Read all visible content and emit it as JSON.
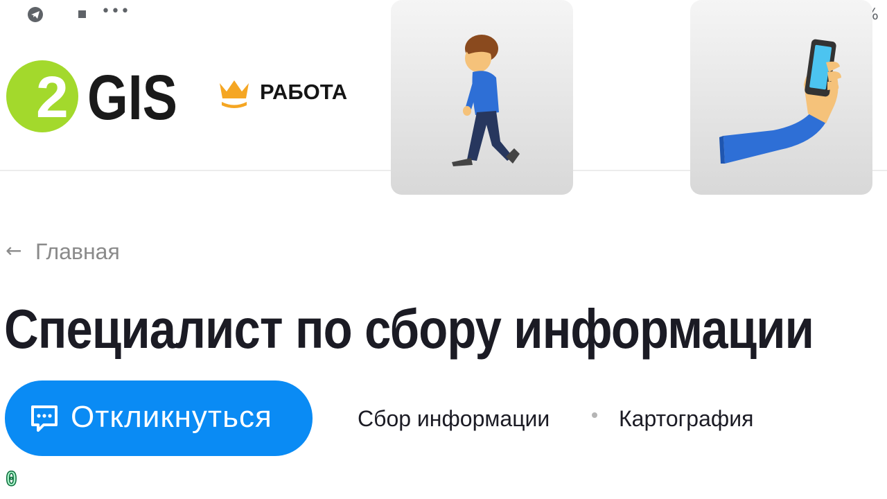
{
  "status_bar": {
    "left_icons": [
      "telegram-icon",
      "stop-icon",
      "more-dots-icon"
    ],
    "dots": "•••",
    "battery_text": "%"
  },
  "header": {
    "logo": {
      "text": "GIS",
      "badge": "2",
      "badge_color": "#a3d92c",
      "text_color": "#1a1a1a"
    },
    "section": {
      "icon": "crown-icon",
      "label": "РАБОТА",
      "icon_color": "#f5a623"
    }
  },
  "stickers": [
    {
      "name": "person-walking-emoji"
    },
    {
      "name": "selfie-arm-emoji"
    }
  ],
  "breadcrumb": {
    "arrow": "←",
    "label": "Главная"
  },
  "vacancy": {
    "title": "Специалист по сбору информации",
    "apply_button": {
      "icon": "chat-icon",
      "label": "Откликнуться",
      "color": "#0a8bf4"
    },
    "tags": [
      "Сбор информации",
      "Картография"
    ]
  },
  "counter": "0"
}
